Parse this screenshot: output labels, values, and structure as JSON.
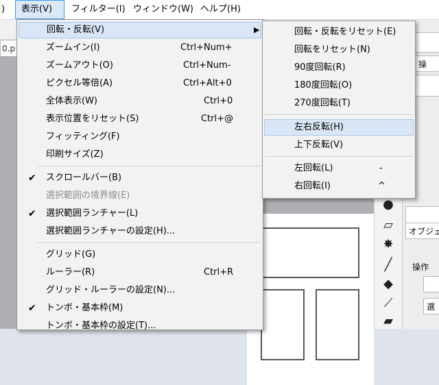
{
  "menubar": {
    "items": [
      {
        "label": ")"
      },
      {
        "label": "表示(V)"
      },
      {
        "label": "フィルター(I)"
      },
      {
        "label": "ウィンドウ(W)"
      },
      {
        "label": "ヘルプ(H)"
      }
    ]
  },
  "background": {
    "doc_tab": "0.p",
    "panel_text_1": "操",
    "panel_text_2": "オブジェク",
    "panel_text_3": "操作",
    "panel_text_4": "選"
  },
  "view_menu": {
    "items": [
      {
        "label": "回転・反転(V)",
        "shortcut": "",
        "checked": false,
        "submenu": true
      },
      {
        "label": "ズームイン(I)",
        "shortcut": "Ctrl+Num+"
      },
      {
        "label": "ズームアウト(O)",
        "shortcut": "Ctrl+Num-"
      },
      {
        "label": "ピクセル等倍(A)",
        "shortcut": "Ctrl+Alt+0"
      },
      {
        "label": "全体表示(W)",
        "shortcut": "Ctrl+0"
      },
      {
        "label": "表示位置をリセット(S)",
        "shortcut": "Ctrl+@"
      },
      {
        "label": "フィッティング(F)",
        "shortcut": ""
      },
      {
        "label": "印刷サイズ(Z)",
        "shortcut": ""
      },
      {
        "label": "スクロールバー(B)",
        "shortcut": "",
        "checked": true
      },
      {
        "label": "選択範囲の境界線(E)",
        "shortcut": "",
        "disabled": true
      },
      {
        "label": "選択範囲ランチャー(L)",
        "shortcut": "",
        "checked": true
      },
      {
        "label": "選択範囲ランチャーの設定(H)...",
        "shortcut": ""
      },
      {
        "label": "グリッド(G)",
        "shortcut": ""
      },
      {
        "label": "ルーラー(R)",
        "shortcut": "Ctrl+R"
      },
      {
        "label": "グリッド・ルーラーの設定(N)...",
        "shortcut": ""
      },
      {
        "label": "トンボ・基本枠(M)",
        "shortcut": "",
        "checked": true
      },
      {
        "label": "トンボ・基本枠の設定(T)...",
        "shortcut": ""
      }
    ],
    "check_glyph": "✔",
    "submenu_arrow": "▶"
  },
  "rotate_submenu": {
    "items": [
      {
        "label": "回転・反転をリセット(E)",
        "shortcut": ""
      },
      {
        "label": "回転をリセット(N)",
        "shortcut": ""
      },
      {
        "label": "90度回転(R)",
        "shortcut": ""
      },
      {
        "label": "180度回転(O)",
        "shortcut": ""
      },
      {
        "label": "270度回転(T)",
        "shortcut": ""
      },
      {
        "label": "左右反転(H)",
        "shortcut": ""
      },
      {
        "label": "上下反転(V)",
        "shortcut": ""
      },
      {
        "label": "左回転(L)",
        "shortcut": "-"
      },
      {
        "label": "右回転(I)",
        "shortcut": "^"
      }
    ]
  },
  "colors": {
    "highlight": "#d9e6f6",
    "highlight_border": "#a9c7ee",
    "menubar_active": "#3399ff"
  },
  "icons": [
    "paint-bucket-icon",
    "eraser-icon",
    "sparkle-icon",
    "line-tool-icon",
    "fill-icon",
    "eyedropper-icon",
    "gradient-icon",
    "magnifier-icon"
  ]
}
